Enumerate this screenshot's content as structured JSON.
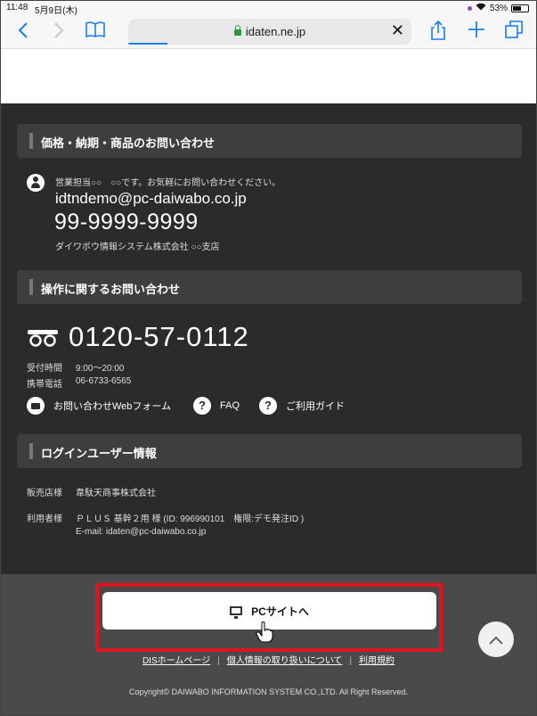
{
  "status_bar": {
    "time": "11:48",
    "date": "5月9日(木)",
    "battery": "53%"
  },
  "toolbar": {
    "url": "idaten.ne.jp"
  },
  "sections": {
    "price_inquiry": {
      "heading": "価格・納期・商品のお問い合わせ",
      "sales_note": "営業担当○○　○○です。お気軽にお問い合わせください。",
      "email": "idtndemo@pc-daiwabo.co.jp",
      "phone": "99-9999-9999",
      "company": "ダイワボウ情報システム株式会社 ○○支店"
    },
    "operation_inquiry": {
      "heading": "操作に関するお問い合わせ",
      "toll_free": "0120-57-0112",
      "hours_label": "受付時間",
      "hours_value": "9:00～20:00",
      "mobile_label": "携帯電話",
      "mobile_value": "06-6733-6565",
      "links": {
        "webform": "お問い合わせWebフォーム",
        "faq": "FAQ",
        "guide": "ご利用ガイド"
      }
    },
    "login_user": {
      "heading": "ログインユーザー情報",
      "shop_label": "販売店様",
      "shop_value": "韋駄天商事株式会社",
      "user_label": "利用者様",
      "user_value": "ＰＬＵＳ 基幹２用 様 (ID: 996990101　権限:デモ発注ID )",
      "user_email": "E-mail: idaten@pc-daiwabo.co.jp"
    }
  },
  "footer": {
    "pc_site_button": "PCサイトへ",
    "links": [
      "DISホームページ",
      "個人情報の取り扱いについて",
      "利用規約"
    ],
    "separator": "|",
    "copyright": "Copyright© DAIWABO INFORMATION SYSTEM CO.,LTD. All Right Reserved."
  },
  "icons": {
    "back": "chevron-left-icon",
    "forward": "chevron-right-icon",
    "bookmarks": "book-icon",
    "share": "share-icon",
    "new_tab": "plus-icon",
    "tabs": "tabs-icon",
    "page_top": "chevron-up-icon"
  },
  "colors": {
    "accent": "#1a7ff0",
    "highlight": "#e0141e",
    "dark_bg": "#2b2b2b",
    "footer_bg": "#4a4a4a"
  }
}
